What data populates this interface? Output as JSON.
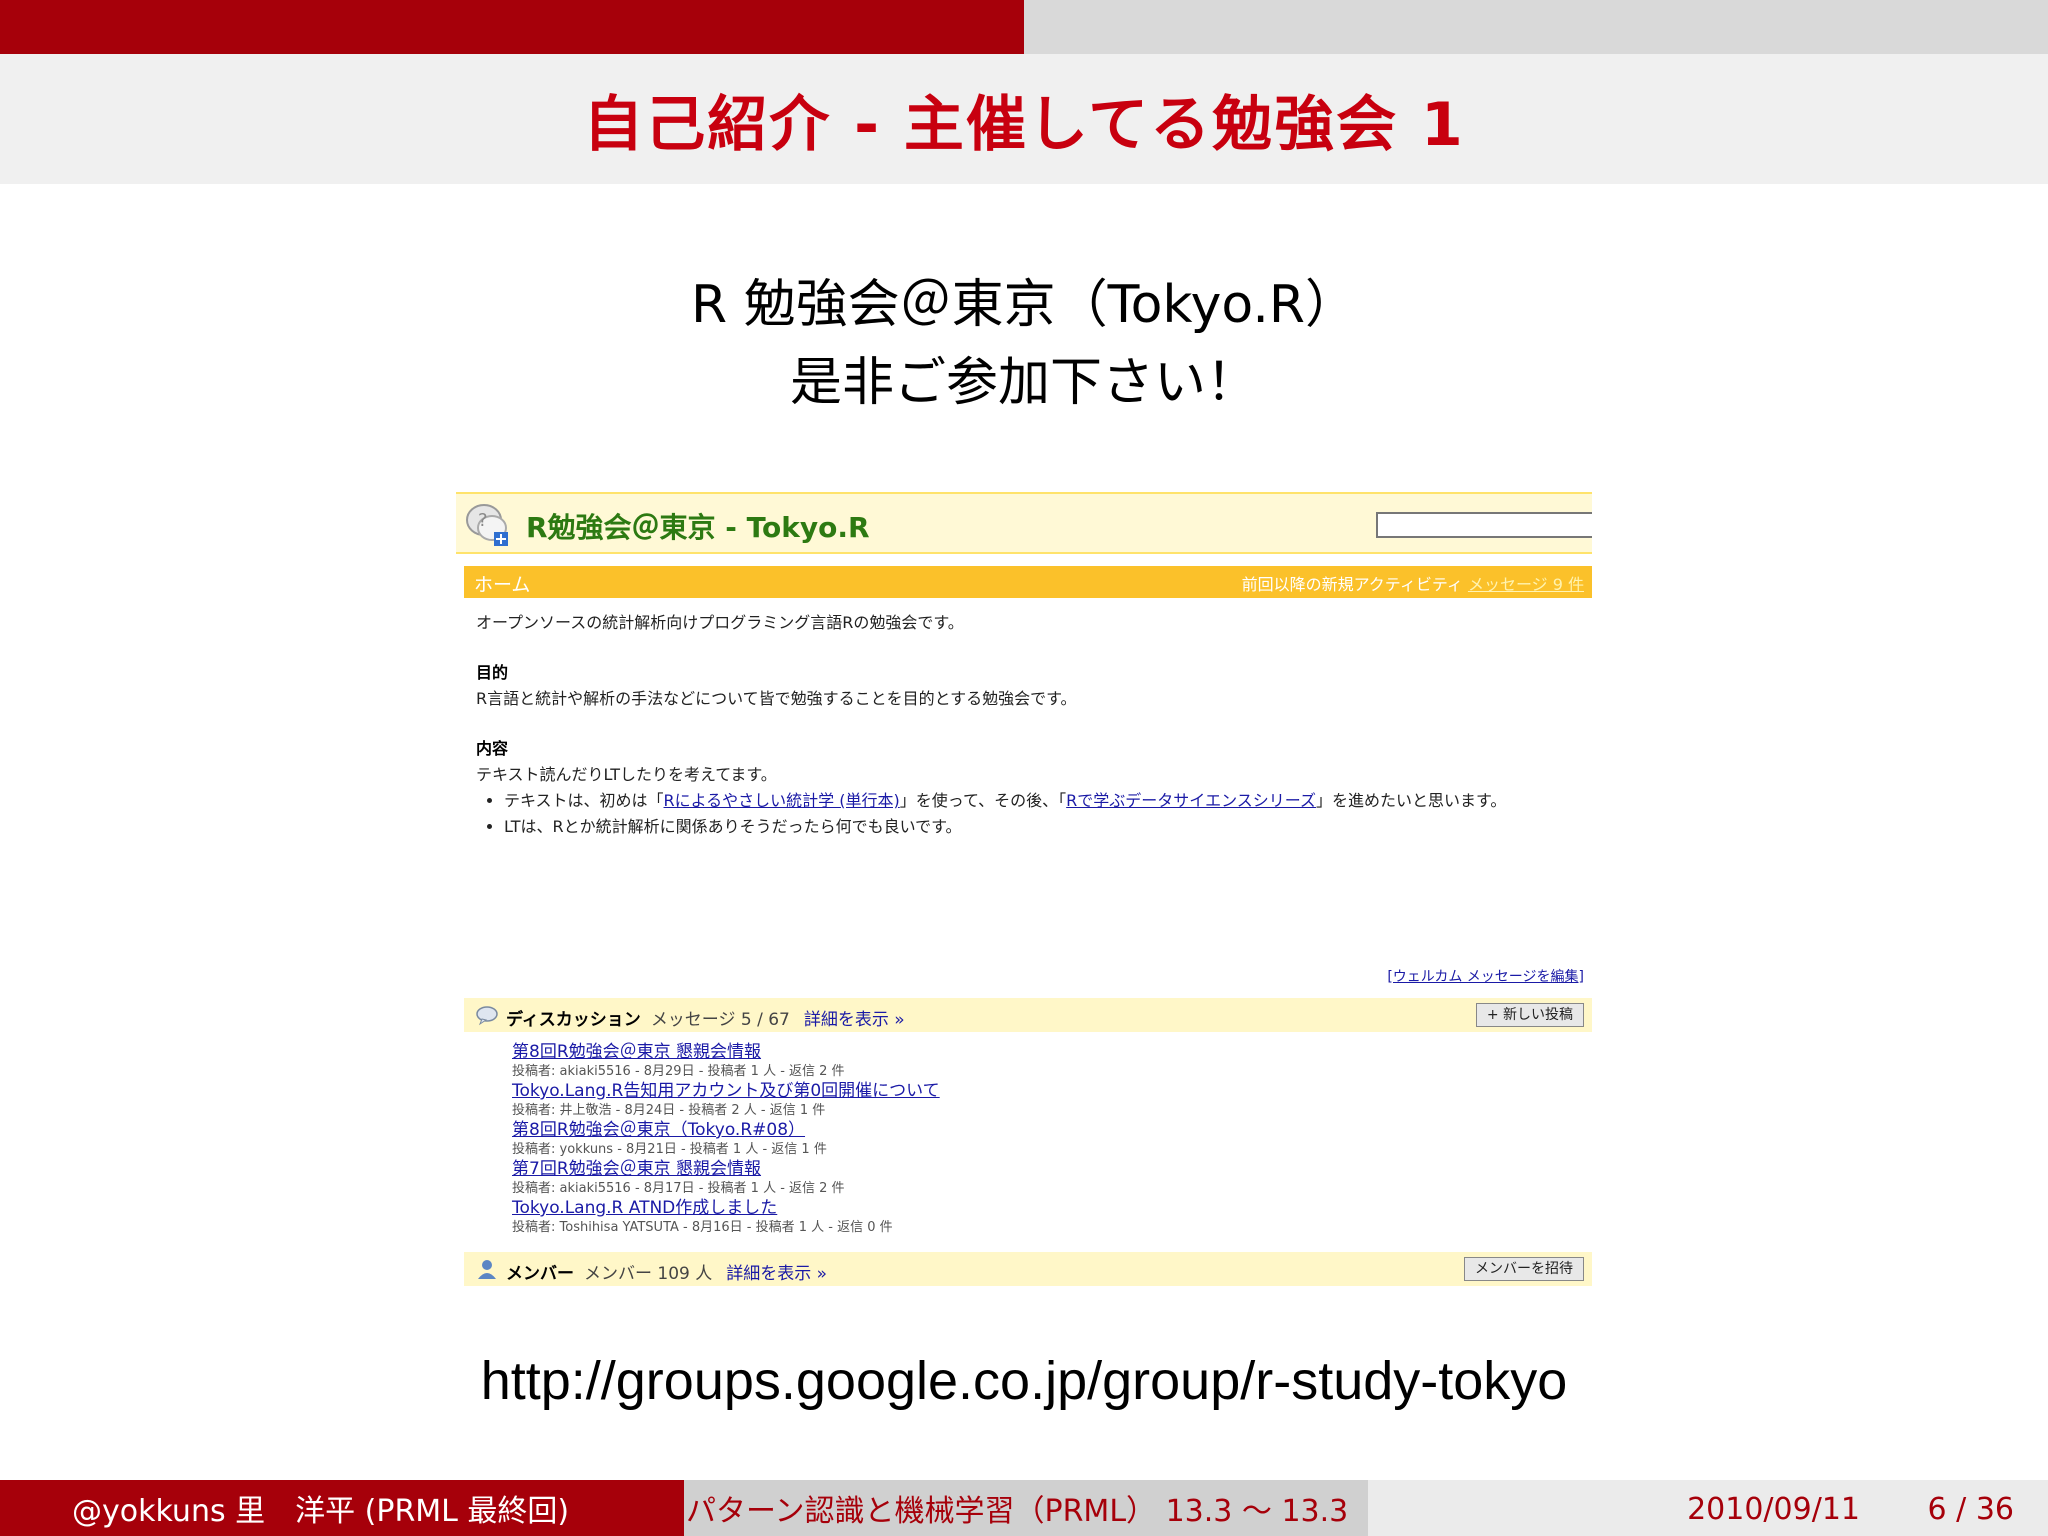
{
  "slide": {
    "title": "自己紹介 - 主催してる勉強会 1",
    "subtitle_line1": "R 勉強会＠東京（Tokyo.R）",
    "subtitle_line2": "是非ご参加下さい！",
    "url": "http://groups.google.co.jp/group/r-study-tokyo",
    "progress": 0.5
  },
  "group_page": {
    "title": "R勉強会＠東京 - Tokyo.R",
    "home_label": "ホーム",
    "activity_label": "前回以降の新規アクティビティ",
    "activity_link": "メッセージ 9 件",
    "intro": "オープンソースの統計解析向けプログラミング言語Rの勉強会です。",
    "purpose_heading": "目的",
    "purpose_text": "R言語と統計や解析の手法などについて皆で勉強することを目的とする勉強会です。",
    "content_heading": "内容",
    "content_text": "テキスト読んだりLTしたりを考えてます。",
    "bullet1_pre": "テキストは、初めは「",
    "bullet1_link1": "Rによるやさしい統計学 (単行本)",
    "bullet1_mid": "」を使って、その後、「",
    "bullet1_link2": "Rで学ぶデータサイエンスシリーズ",
    "bullet1_post": "」を進めたいと思います。",
    "bullet2": "LTは、Rとか統計解析に関係ありそうだったら何でも良いです。",
    "edit_welcome": "[ウェルカム メッセージを編集]",
    "discussion": {
      "label": "ディスカッション",
      "count": "メッセージ 5 / 67",
      "details": "詳細を表示 »",
      "new_post": "+ 新しい投稿",
      "posts": [
        {
          "title": "第8回R勉強会＠東京 懇親会情報",
          "meta": "投稿者: akiaki5516 - 8月29日 - 投稿者 1 人 - 返信 2 件"
        },
        {
          "title": "Tokyo.Lang.R告知用アカウント及び第0回開催について",
          "meta": "投稿者: 井上敬浩 - 8月24日 - 投稿者 2 人 - 返信 1 件"
        },
        {
          "title": "第8回R勉強会＠東京（Tokyo.R#08）",
          "meta": "投稿者: yokkuns - 8月21日 - 投稿者 1 人 - 返信 1 件"
        },
        {
          "title": "第7回R勉強会＠東京 懇親会情報",
          "meta": "投稿者: akiaki5516 - 8月17日 - 投稿者 1 人 - 返信 2 件"
        },
        {
          "title": "Tokyo.Lang.R ATND作成しました",
          "meta": "投稿者: Toshihisa YATSUTA - 8月16日 - 投稿者 1 人 - 返信 0 件"
        }
      ]
    },
    "members": {
      "label": "メンバー",
      "count": "メンバー 109 人",
      "details": "詳細を表示 »",
      "invite": "メンバーを招待"
    }
  },
  "footer": {
    "author": "@yokkuns 里　洋平 (PRML 最終回)",
    "talk": "パターン認識と機械学習（PRML） 13.3 〜 13.3",
    "date": "2010/09/11",
    "page": "6 / 36"
  },
  "colors": {
    "accent": "#a6000a",
    "title_red": "#c8000f",
    "group_green": "#2d7a12",
    "home_bar": "#fbc12a"
  }
}
